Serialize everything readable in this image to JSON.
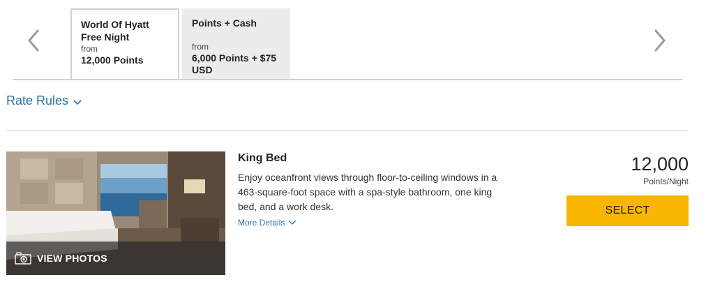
{
  "tabs": [
    {
      "title": "World Of Hyatt Free Night",
      "from_label": "from",
      "price": "12,000 Points",
      "active": true
    },
    {
      "title": "Points + Cash",
      "from_label": "from",
      "price": "6,000 Points + $75 USD",
      "active": false
    }
  ],
  "icons": {
    "prev": "chevron-left-icon",
    "next": "chevron-right-icon",
    "rate_rules_caret": "chevron-down-icon",
    "more_details_caret": "chevron-down-icon",
    "camera": "camera-icon"
  },
  "rate_rules": {
    "label": "Rate Rules"
  },
  "room": {
    "name": "King Bed",
    "description": "Enjoy oceanfront views through floor-to-ceiling windows in a 463-square-foot space with a spa-style bathroom, one king bed, and a work desk.",
    "more_details": "More Details",
    "view_photos": "VIEW PHOTOS",
    "price": "12,000",
    "price_unit": "Points/Night",
    "select_label": "Select"
  },
  "colors": {
    "link": "#2a6fa8",
    "select_button": "#f8b600",
    "inactive_tab": "#ececec",
    "chevron": "#9a9a9a"
  }
}
